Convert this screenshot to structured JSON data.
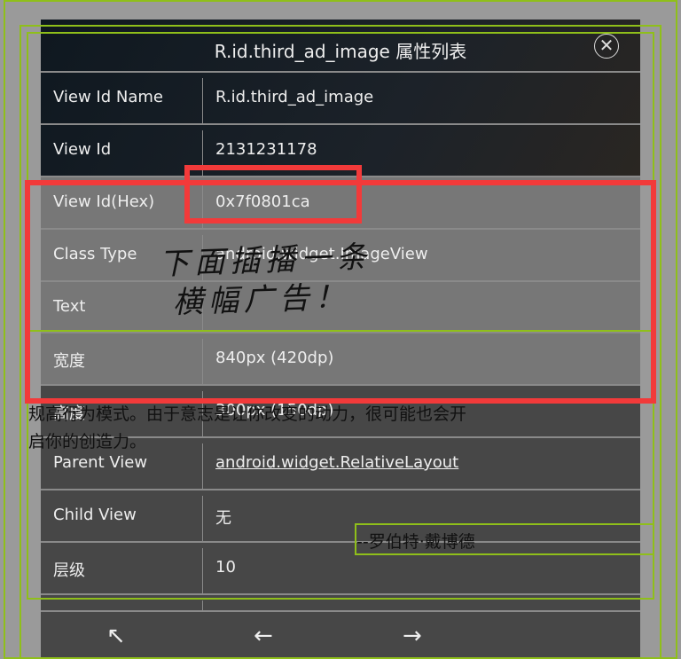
{
  "background": {
    "quote_line1": "规高行为模式。由于意志是让你改变的动力，很可能也会开",
    "quote_line2": "启你的创造力。",
    "author": "--罗伯特·戴博德"
  },
  "dialog": {
    "title": "R.id.third_ad_image 属性列表",
    "close_icon": "circle-x-icon",
    "rows": [
      {
        "key": "View Id Name",
        "value": "R.id.third_ad_image"
      },
      {
        "key": "View Id",
        "value": "2131231178"
      },
      {
        "key": "View Id(Hex)",
        "value": "0x7f0801ca"
      },
      {
        "key": "Class Type",
        "value": "android.widget.ImageView"
      },
      {
        "key": "Text",
        "value": ""
      },
      {
        "key": "宽度",
        "value": "840px (420dp)"
      },
      {
        "key": "高度",
        "value": "300px (150dp)"
      },
      {
        "key": "Parent View",
        "value": "android.widget.RelativeLayout"
      },
      {
        "key": "Child View",
        "value": "无"
      },
      {
        "key": "层级",
        "value": "10"
      }
    ],
    "toolbar": {
      "up_parent": "↖",
      "previous": "←",
      "next": "→"
    }
  },
  "annotation": {
    "line1": "下面插播一条",
    "line2": "横幅广告！",
    "color": "#f23a3a"
  }
}
